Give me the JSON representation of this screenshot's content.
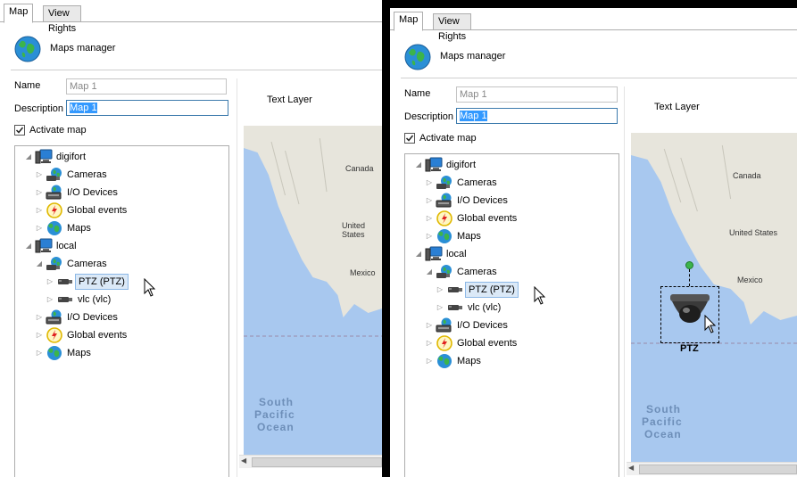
{
  "tabs": [
    "Map",
    "View Rights"
  ],
  "header": {
    "title": "Maps manager"
  },
  "form": {
    "name_label": "Name",
    "name_value": "Map 1",
    "description_label": "Description",
    "description_value": "Map 1",
    "activate_label": "Activate map",
    "activate_checked": true
  },
  "tree": [
    {
      "label": "digifort",
      "icon": "computer-icon",
      "indent": 0,
      "expanded": true
    },
    {
      "label": "Cameras",
      "icon": "cameras-icon",
      "indent": 1
    },
    {
      "label": "I/O Devices",
      "icon": "io-devices-icon",
      "indent": 1
    },
    {
      "label": "Global events",
      "icon": "global-events-icon",
      "indent": 1
    },
    {
      "label": "Maps",
      "icon": "globe-icon",
      "indent": 1
    },
    {
      "label": "local",
      "icon": "computer-icon",
      "indent": 0,
      "expanded": true
    },
    {
      "label": "Cameras",
      "icon": "cameras-icon",
      "indent": 1,
      "expanded": true
    },
    {
      "label": "PTZ (PTZ)",
      "icon": "camera-icon",
      "indent": 2,
      "selected": true
    },
    {
      "label": "vlc (vlc)",
      "icon": "camera-icon",
      "indent": 2
    },
    {
      "label": "I/O Devices",
      "icon": "io-devices-icon",
      "indent": 1
    },
    {
      "label": "Global events",
      "icon": "global-events-icon",
      "indent": 1
    },
    {
      "label": "Maps",
      "icon": "globe-icon",
      "indent": 1
    }
  ],
  "map": {
    "layer_label": "Text Layer",
    "places": {
      "canada": "Canada",
      "us": "United States",
      "mexico": "Mexico",
      "ocean_1": "South",
      "ocean_2": "Pacific",
      "ocean_3": "Ocean"
    },
    "camera_label": "PTZ"
  },
  "colors": {
    "water": "#a8c8ef",
    "land": "#e7e5dc",
    "selection": "#3399ff",
    "tree_selected": "#dbe9f7"
  }
}
